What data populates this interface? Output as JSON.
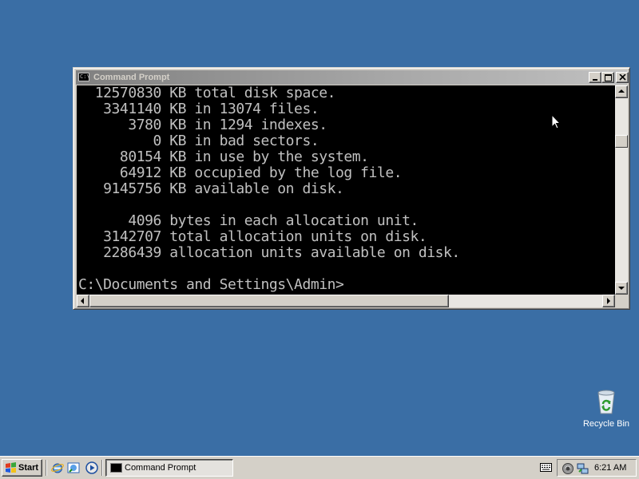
{
  "window": {
    "title": "Command Prompt",
    "icon": "console-icon",
    "controls": [
      "minimize-icon",
      "maximize-icon",
      "close-icon"
    ]
  },
  "console": {
    "lines": [
      "  12570830 KB total disk space.",
      "   3341140 KB in 13074 files.",
      "      3780 KB in 1294 indexes.",
      "         0 KB in bad sectors.",
      "     80154 KB in use by the system.",
      "     64912 KB occupied by the log file.",
      "   9145756 KB available on disk.",
      "",
      "      4096 bytes in each allocation unit.",
      "   3142707 total allocation units on disk.",
      "   2286439 allocation units available on disk.",
      "",
      "C:\\Documents and Settings\\Admin>"
    ],
    "colors": {
      "background": "#000000",
      "text": "#c0c0c0"
    }
  },
  "desktop": {
    "background_color": "#3a6ea5",
    "icons": [
      {
        "label": "Recycle Bin",
        "icon": "recycle-bin-icon"
      }
    ]
  },
  "taskbar": {
    "start_label": "Start",
    "quick_launch": [
      "internet-explorer-icon",
      "outlook-express-icon",
      "media-player-icon"
    ],
    "tasks": [
      {
        "label": "Command Prompt",
        "icon": "console-icon"
      }
    ],
    "tray_icons": [
      "keyboard-icon",
      "volume-icon",
      "network-icon"
    ],
    "clock": "6:21 AM"
  }
}
